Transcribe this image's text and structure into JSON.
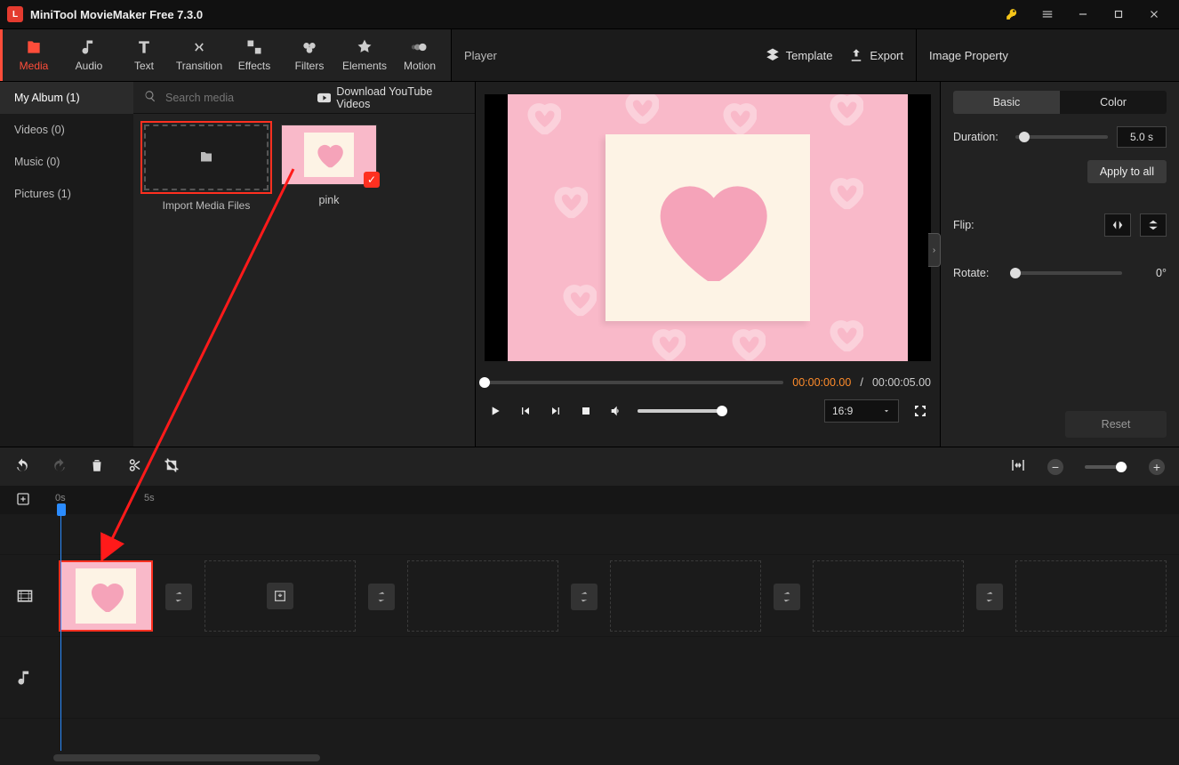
{
  "app": {
    "title": "MiniTool MovieMaker Free 7.3.0"
  },
  "tabs": [
    {
      "label": "Media",
      "name": "tab-media",
      "active": true
    },
    {
      "label": "Audio",
      "name": "tab-audio"
    },
    {
      "label": "Text",
      "name": "tab-text"
    },
    {
      "label": "Transition",
      "name": "tab-transition"
    },
    {
      "label": "Effects",
      "name": "tab-effects"
    },
    {
      "label": "Filters",
      "name": "tab-filters"
    },
    {
      "label": "Elements",
      "name": "tab-elements"
    },
    {
      "label": "Motion",
      "name": "tab-motion"
    }
  ],
  "player_header": {
    "label": "Player",
    "template": "Template",
    "export": "Export"
  },
  "prop_header": {
    "label": "Image Property"
  },
  "sidebar": {
    "items": [
      {
        "label": "My Album (1)",
        "active": true
      },
      {
        "label": "Videos (0)"
      },
      {
        "label": "Music (0)"
      },
      {
        "label": "Pictures (1)"
      }
    ]
  },
  "search": {
    "placeholder": "Search media"
  },
  "yt": {
    "label": "Download YouTube Videos"
  },
  "import": {
    "label": "Import Media Files"
  },
  "thumb1": {
    "label": "pink"
  },
  "time": {
    "current": "00:00:00.00",
    "sep": "/",
    "total": "00:00:05.00"
  },
  "ratio": {
    "value": "16:9"
  },
  "prop": {
    "tab_basic": "Basic",
    "tab_color": "Color",
    "duration_label": "Duration:",
    "duration_value": "5.0 s",
    "apply": "Apply to all",
    "flip_label": "Flip:",
    "rotate_label": "Rotate:",
    "rotate_value": "0°",
    "reset": "Reset"
  },
  "ruler": {
    "t0": "0s",
    "t1": "5s"
  }
}
